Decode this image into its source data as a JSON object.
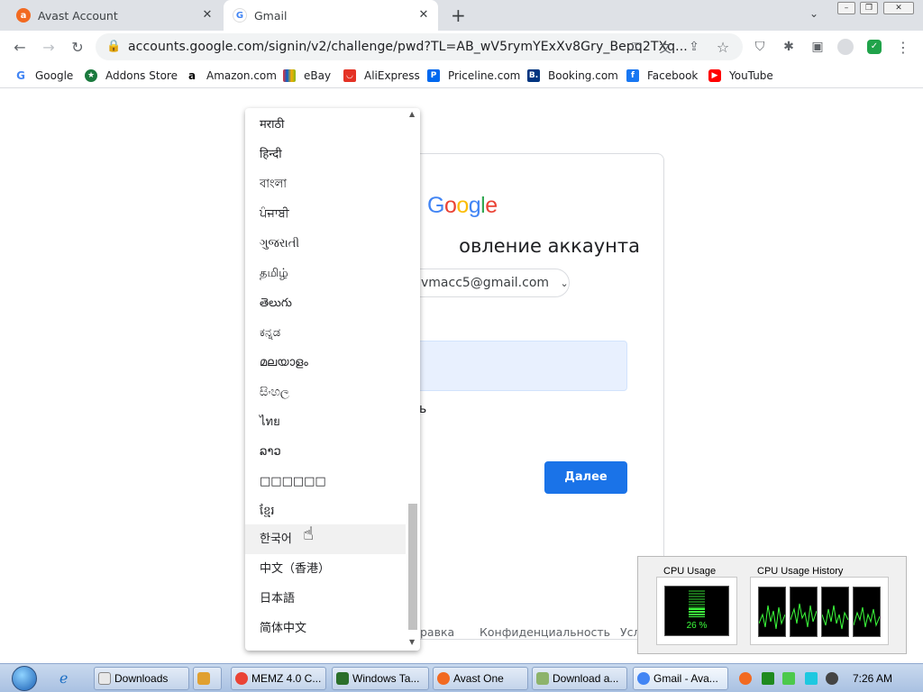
{
  "tabs": [
    {
      "title": "Avast Account"
    },
    {
      "title": "Gmail"
    }
  ],
  "toolbar": {
    "url": "accounts.google.com/signin/v2/challenge/pwd?TL=AB_wV5rymYExXv8Gry_Bepq2TXq..."
  },
  "bookmarks": [
    {
      "label": "Google"
    },
    {
      "label": "Addons Store"
    },
    {
      "label": "Amazon.com"
    },
    {
      "label": "eBay"
    },
    {
      "label": "AliExpress"
    },
    {
      "label": "Priceline.com"
    },
    {
      "label": "Booking.com"
    },
    {
      "label": "Facebook"
    },
    {
      "label": "YouTube"
    }
  ],
  "page": {
    "logo": "Google",
    "heading": "овление аккаунта",
    "account_email": "vmacc5@gmail.com",
    "show_password_fragment": "ль",
    "next_button": "Далее",
    "footer": {
      "help": "равка",
      "privacy": "Конфиденциальность",
      "terms": "Усл"
    }
  },
  "language_dropdown": {
    "items": [
      "मराठी",
      "हिन्दी",
      "বাংলা",
      "ਪੰਜਾਬੀ",
      "ગુજરાતી",
      "தமிழ்",
      "తెలుగు",
      "ಕನ್ನಡ",
      "മലയാളം",
      "සිංහල",
      "ไทย",
      "ລາວ",
      "□□□□□□",
      "ខ្មែរ",
      "한국어",
      "中文（香港）",
      "日本語",
      "简体中文"
    ],
    "highlighted_index": 14
  },
  "cpu_widget": {
    "usage_title": "CPU Usage",
    "history_title": "CPU Usage History",
    "usage_value": "26 %"
  },
  "taskbar": {
    "items": [
      {
        "label": "Downloads"
      },
      {
        "label": ""
      },
      {
        "label": "MEMZ 4.0 C..."
      },
      {
        "label": "Windows Ta..."
      },
      {
        "label": "Avast One"
      },
      {
        "label": "Download a..."
      },
      {
        "label": "Gmail - Ava..."
      }
    ],
    "clock": "7:26 AM"
  }
}
